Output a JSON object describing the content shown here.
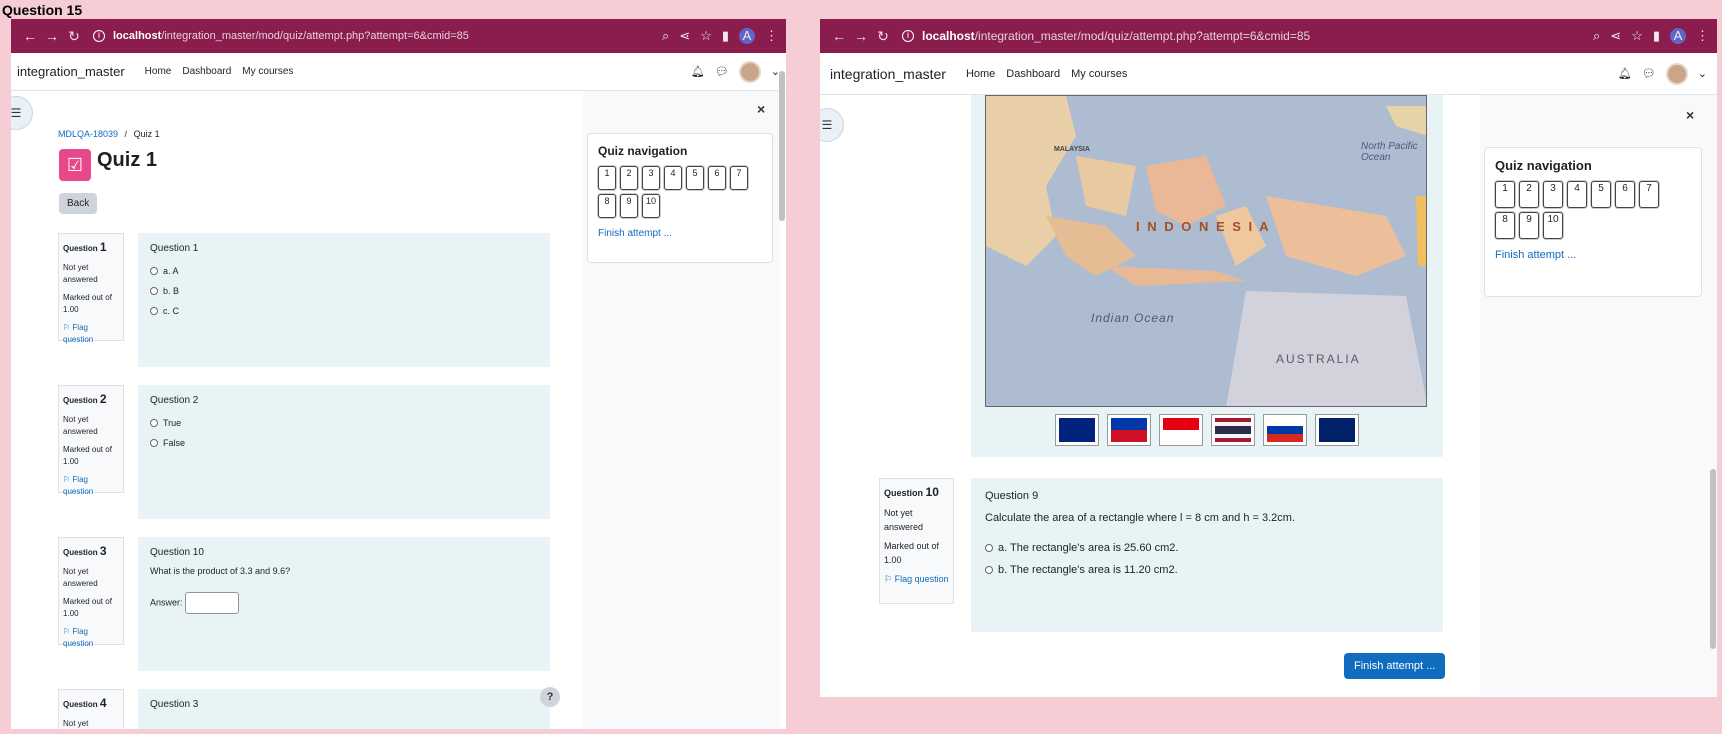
{
  "page_label": "Question 15",
  "browser": {
    "url_host": "localhost",
    "url_path": "/integration_master/mod/quiz/attempt.php?attempt=6&cmid=85",
    "profile_initial": "A"
  },
  "site": {
    "brand": "integration_master",
    "nav": [
      "Home",
      "Dashboard",
      "My courses"
    ]
  },
  "breadcrumb": {
    "course": "MDLQA-18039",
    "separator": "/",
    "current": "Quiz 1"
  },
  "quiz": {
    "title": "Quiz 1",
    "back_label": "Back"
  },
  "quiz_nav": {
    "title": "Quiz navigation",
    "buttons": [
      "1",
      "2",
      "3",
      "4",
      "5",
      "6",
      "7",
      "8",
      "9",
      "10"
    ],
    "finish_link": "Finish attempt ...",
    "close": "×"
  },
  "questions": [
    {
      "number_prefix": "Question",
      "number": "1",
      "state": "Not yet answered",
      "marks": "Marked out of 1.00",
      "flag": "Flag question",
      "title": "Question 1",
      "options": [
        "a.   A",
        "b.   B",
        "c.   C"
      ]
    },
    {
      "number_prefix": "Question",
      "number": "2",
      "state": "Not yet answered",
      "marks": "Marked out of 1.00",
      "flag": "Flag question",
      "title": "Question 2",
      "options": [
        "True",
        "False"
      ]
    },
    {
      "number_prefix": "Question",
      "number": "3",
      "state": "Not yet answered",
      "marks": "Marked out of 1.00",
      "flag": "Flag question",
      "title": "Question 10",
      "text": "What is the product of 3.3 and 9.6?",
      "answer_label": "Answer:"
    },
    {
      "number_prefix": "Question",
      "number": "4",
      "state": "Not yet answered",
      "title": "Question 3"
    }
  ],
  "right_question": {
    "number_prefix": "Question",
    "number": "10",
    "state": "Not yet answered",
    "marks": "Marked out of 1.00",
    "flag": "Flag question",
    "title": "Question 9",
    "text": "Calculate the area of a rectangle where l = 8 cm  and h = 3.2cm.",
    "options": [
      "a. The rectangle's area is 25.60 cm2.",
      "b. The rectangle's area is 11.20 cm2."
    ]
  },
  "map_labels": {
    "country": "I N D O N E S I A",
    "ocean": "Indian Ocean",
    "australia": "AUSTRALIA",
    "pacific": "North Pacific Ocean",
    "malaysia": "MALAYSIA"
  },
  "finish_button": "Finish attempt ...",
  "help": "?",
  "colors": {
    "chrome": "#8a1d4d",
    "accent": "#0f6cbf",
    "question_bg": "#e7f3f5",
    "background": "#f7cdd5"
  }
}
